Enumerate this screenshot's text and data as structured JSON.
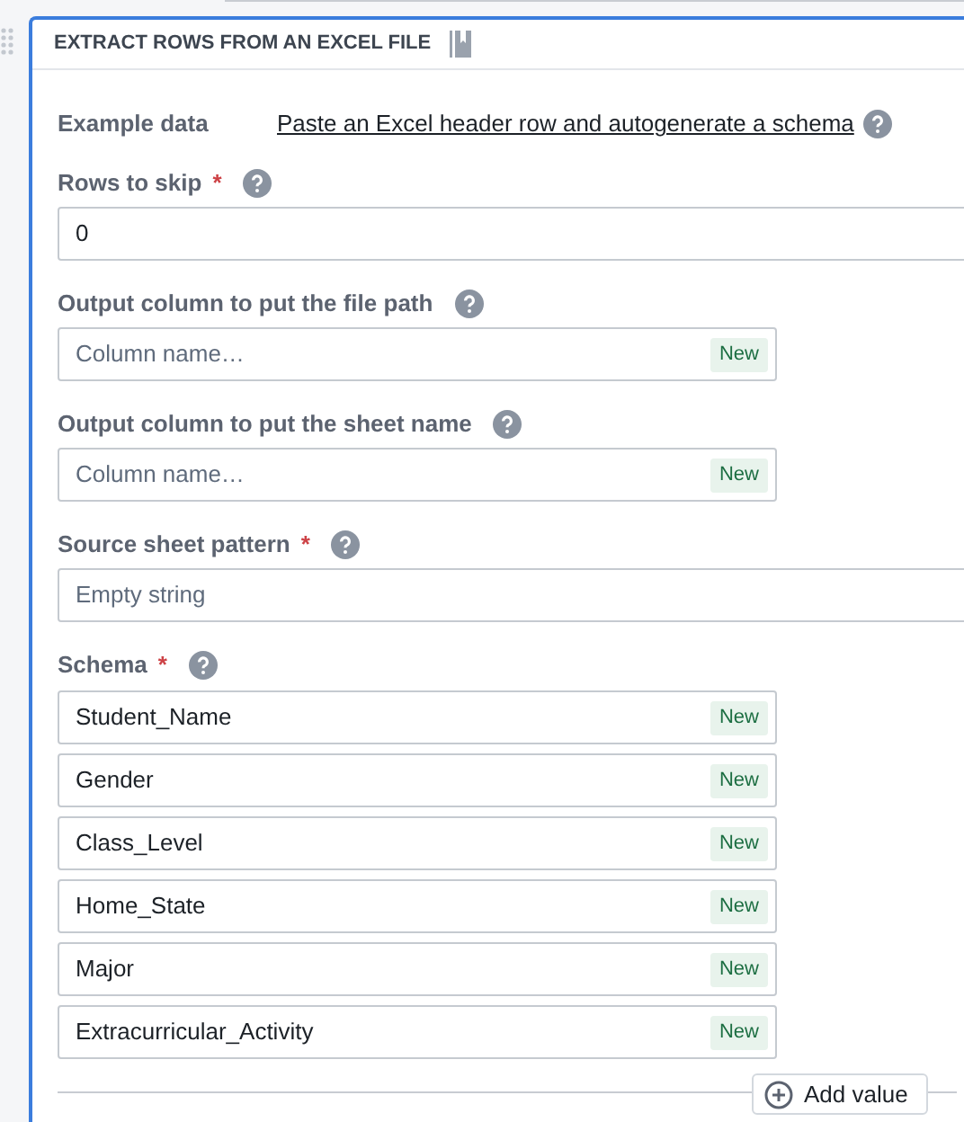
{
  "header": {
    "title": "EXTRACT ROWS FROM AN EXCEL FILE"
  },
  "example_data": {
    "label": "Example data",
    "link": "Paste an Excel header row and autogenerate a schema"
  },
  "fields": [
    {
      "kind": "text",
      "label": "Rows to skip",
      "required_mark": "*",
      "value": "0"
    },
    {
      "kind": "column",
      "label": "Output column to put the file path",
      "placeholder": "Column name…",
      "badge": "New"
    },
    {
      "kind": "column",
      "label": "Output column to put the sheet name",
      "placeholder": "Column name…",
      "badge": "New"
    },
    {
      "kind": "text",
      "label": "Source sheet pattern",
      "required_mark": "*",
      "placeholder": "Empty string"
    }
  ],
  "schema": {
    "label": "Schema",
    "required_mark": "*",
    "items": [
      {
        "value": "Student_Name",
        "badge": "New"
      },
      {
        "value": "Gender",
        "badge": "New"
      },
      {
        "value": "Class_Level",
        "badge": "New"
      },
      {
        "value": "Home_State",
        "badge": "New"
      },
      {
        "value": "Major",
        "badge": "New"
      },
      {
        "value": "Extracurricular_Activity",
        "badge": "New"
      }
    ],
    "add_button": "Add value"
  }
}
